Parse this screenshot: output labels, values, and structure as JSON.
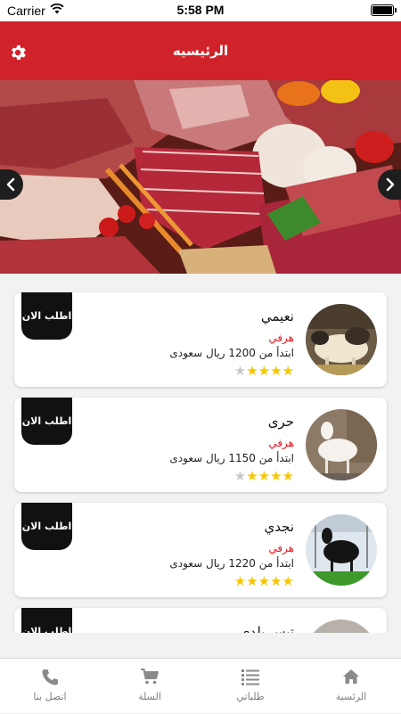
{
  "status_bar": {
    "carrier": "Carrier",
    "time": "5:58 PM"
  },
  "header": {
    "title": "الرئيسيه",
    "settings_icon": "gear-icon"
  },
  "banner": {
    "prev_icon": "chevron-left-icon",
    "next_icon": "chevron-right-icon"
  },
  "products": [
    {
      "name": "نعيمي",
      "type": "هرفي",
      "price": "ابتدأ من 1200 ريال سعودى",
      "rating": 4,
      "order_label": "اطلب الان"
    },
    {
      "name": "حرى",
      "type": "هرفي",
      "price": "ابتدأ من 1150 ريال سعودى",
      "rating": 4,
      "order_label": "اطلب الان"
    },
    {
      "name": "نجدي",
      "type": "هرفي",
      "price": "ابتدأ من 1220 ريال سعودى",
      "rating": 5,
      "order_label": "اطلب الان"
    },
    {
      "name": "تيس بلدي",
      "type": "",
      "price": "",
      "rating": 0,
      "order_label": "اطلب الان"
    }
  ],
  "tabs": [
    {
      "label": "الرئسية",
      "icon": "home-icon"
    },
    {
      "label": "طلباتي",
      "icon": "list-icon"
    },
    {
      "label": "السلة",
      "icon": "cart-icon"
    },
    {
      "label": "اتصل بنا",
      "icon": "phone-icon"
    }
  ],
  "colors": {
    "header": "#d0222a",
    "accent_red": "#e0141e",
    "star": "#f7c600",
    "order_button": "#111111"
  }
}
